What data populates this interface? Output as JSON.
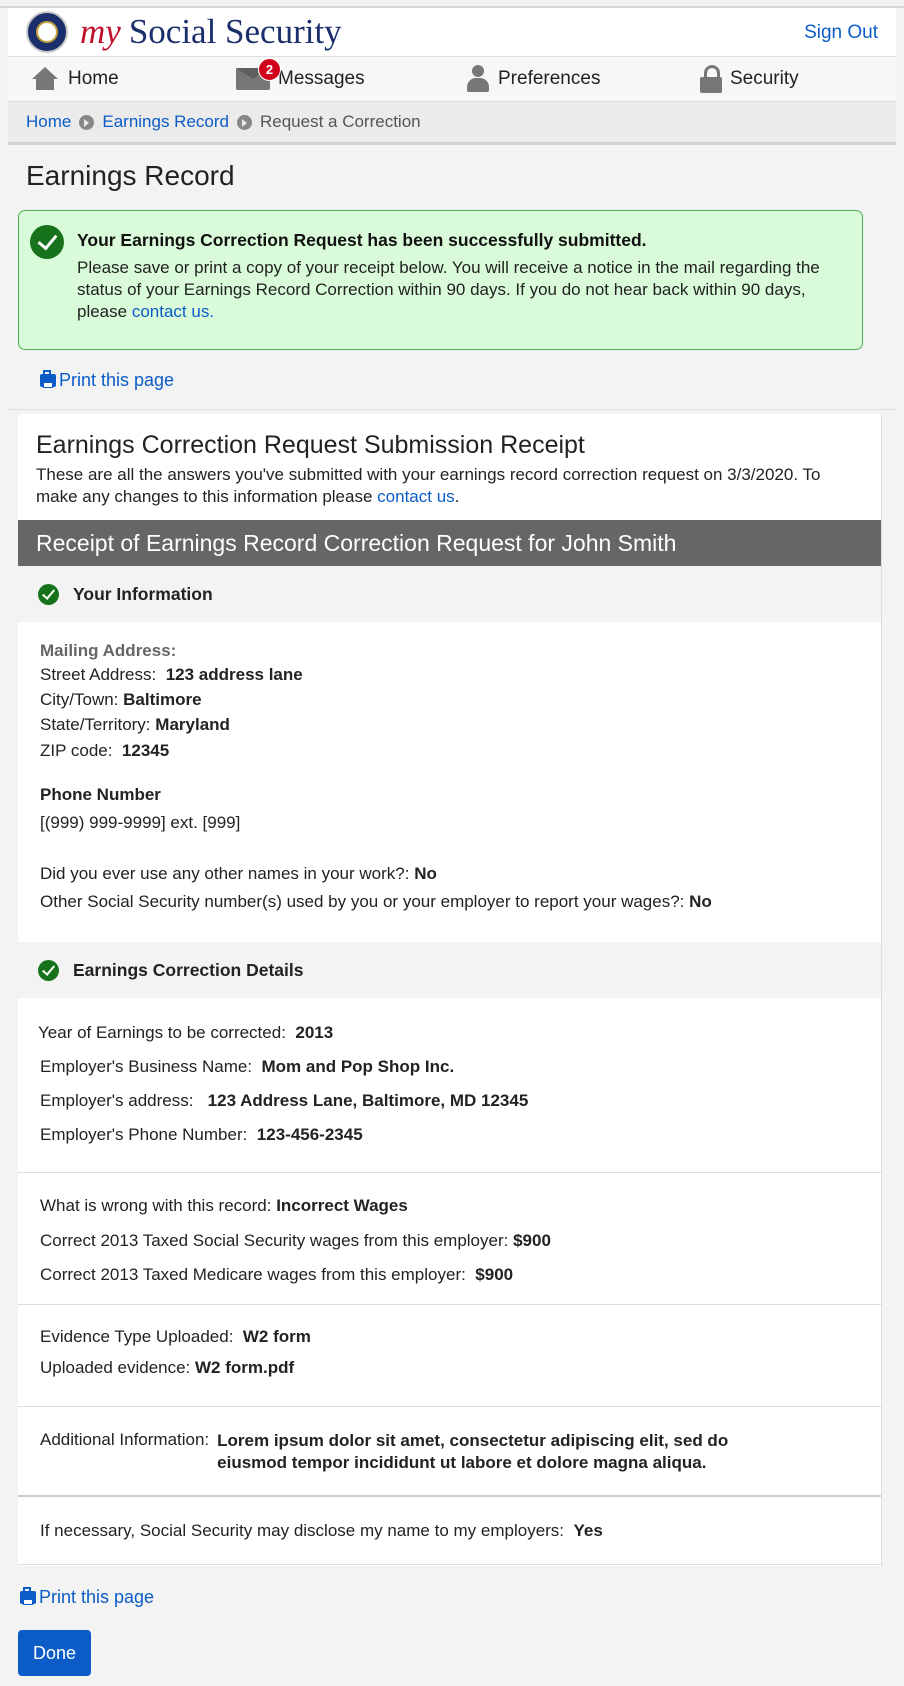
{
  "header": {
    "brand_my": "my",
    "brand_name": "Social Security",
    "sign_out": "Sign Out"
  },
  "nav": {
    "home": "Home",
    "messages": "Messages",
    "messages_count": "2",
    "preferences": "Preferences",
    "security": "Security"
  },
  "breadcrumb": {
    "home": "Home",
    "earnings_record": "Earnings Record",
    "current": "Request a Correction"
  },
  "page_title": "Earnings Record",
  "alert": {
    "title": "Your Earnings Correction Request has been successfully submitted.",
    "body": "Please save or print a copy of your receipt below. You will receive a notice in the mail regarding the status of your Earnings Record Correction within 90 days. If you do not hear back within 90 days, please",
    "link": "contact us."
  },
  "print_label": "Print this page",
  "receipt": {
    "title": "Earnings Correction Request Submission Receipt",
    "intro": "These are all the answers you've submitted with your earnings record correction request on 3/3/2020. To make any changes to this information please",
    "intro_link": "contact us",
    "intro_end": ".",
    "banner": "Receipt of Earnings Record Correction Request for John Smith"
  },
  "your_info": {
    "heading": "Your Information",
    "mailing_label": "Mailing Address:",
    "street_label": "Street Address:",
    "street": "123 address lane",
    "city_label": "City/Town:",
    "city": "Baltimore",
    "state_label": "State/Territory:",
    "state": "Maryland",
    "zip_label": "ZIP code:",
    "zip": "12345",
    "phone_heading": "Phone Number",
    "phone": "[(999) 999-9999] ext. [999]",
    "other_names_label": "Did you ever use any other names in your work?:",
    "other_names": "No",
    "other_ssn_label": "Other Social Security number(s) used by you or your employer to report your wages?:",
    "other_ssn": "No"
  },
  "details": {
    "heading": "Earnings Correction Details",
    "year_label": "Year of Earnings to be corrected:",
    "year": "2013",
    "business_label": "Employer's Business Name:",
    "business": "Mom and Pop Shop Inc.",
    "address_label": "Employer's address:",
    "address": "123 Address Lane, Baltimore, MD 12345",
    "phone_label": "Employer's Phone Number:",
    "phone": "123-456-2345",
    "wrong_label": "What is wrong with this record:",
    "wrong": "Incorrect Wages",
    "ss_wages_label": "Correct 2013  Taxed Social Security wages from this employer:",
    "ss_wages": "$900",
    "medicare_label": "Correct 2013  Taxed Medicare wages from this employer:",
    "medicare": "$900",
    "evidence_type_label": "Evidence Type Uploaded:",
    "evidence_type": "W2 form",
    "evidence_file_label": "Uploaded evidence:",
    "evidence_file": "W2 form.pdf",
    "additional_label": "Additional Information:",
    "additional": "Lorem ipsum dolor sit amet, consectetur adipiscing elit, sed do eiusmod tempor incididunt ut labore et dolore magna aliqua.",
    "disclose_label": "If necessary, Social Security may disclose my name to my employers:",
    "disclose": "Yes"
  },
  "done_label": "Done"
}
